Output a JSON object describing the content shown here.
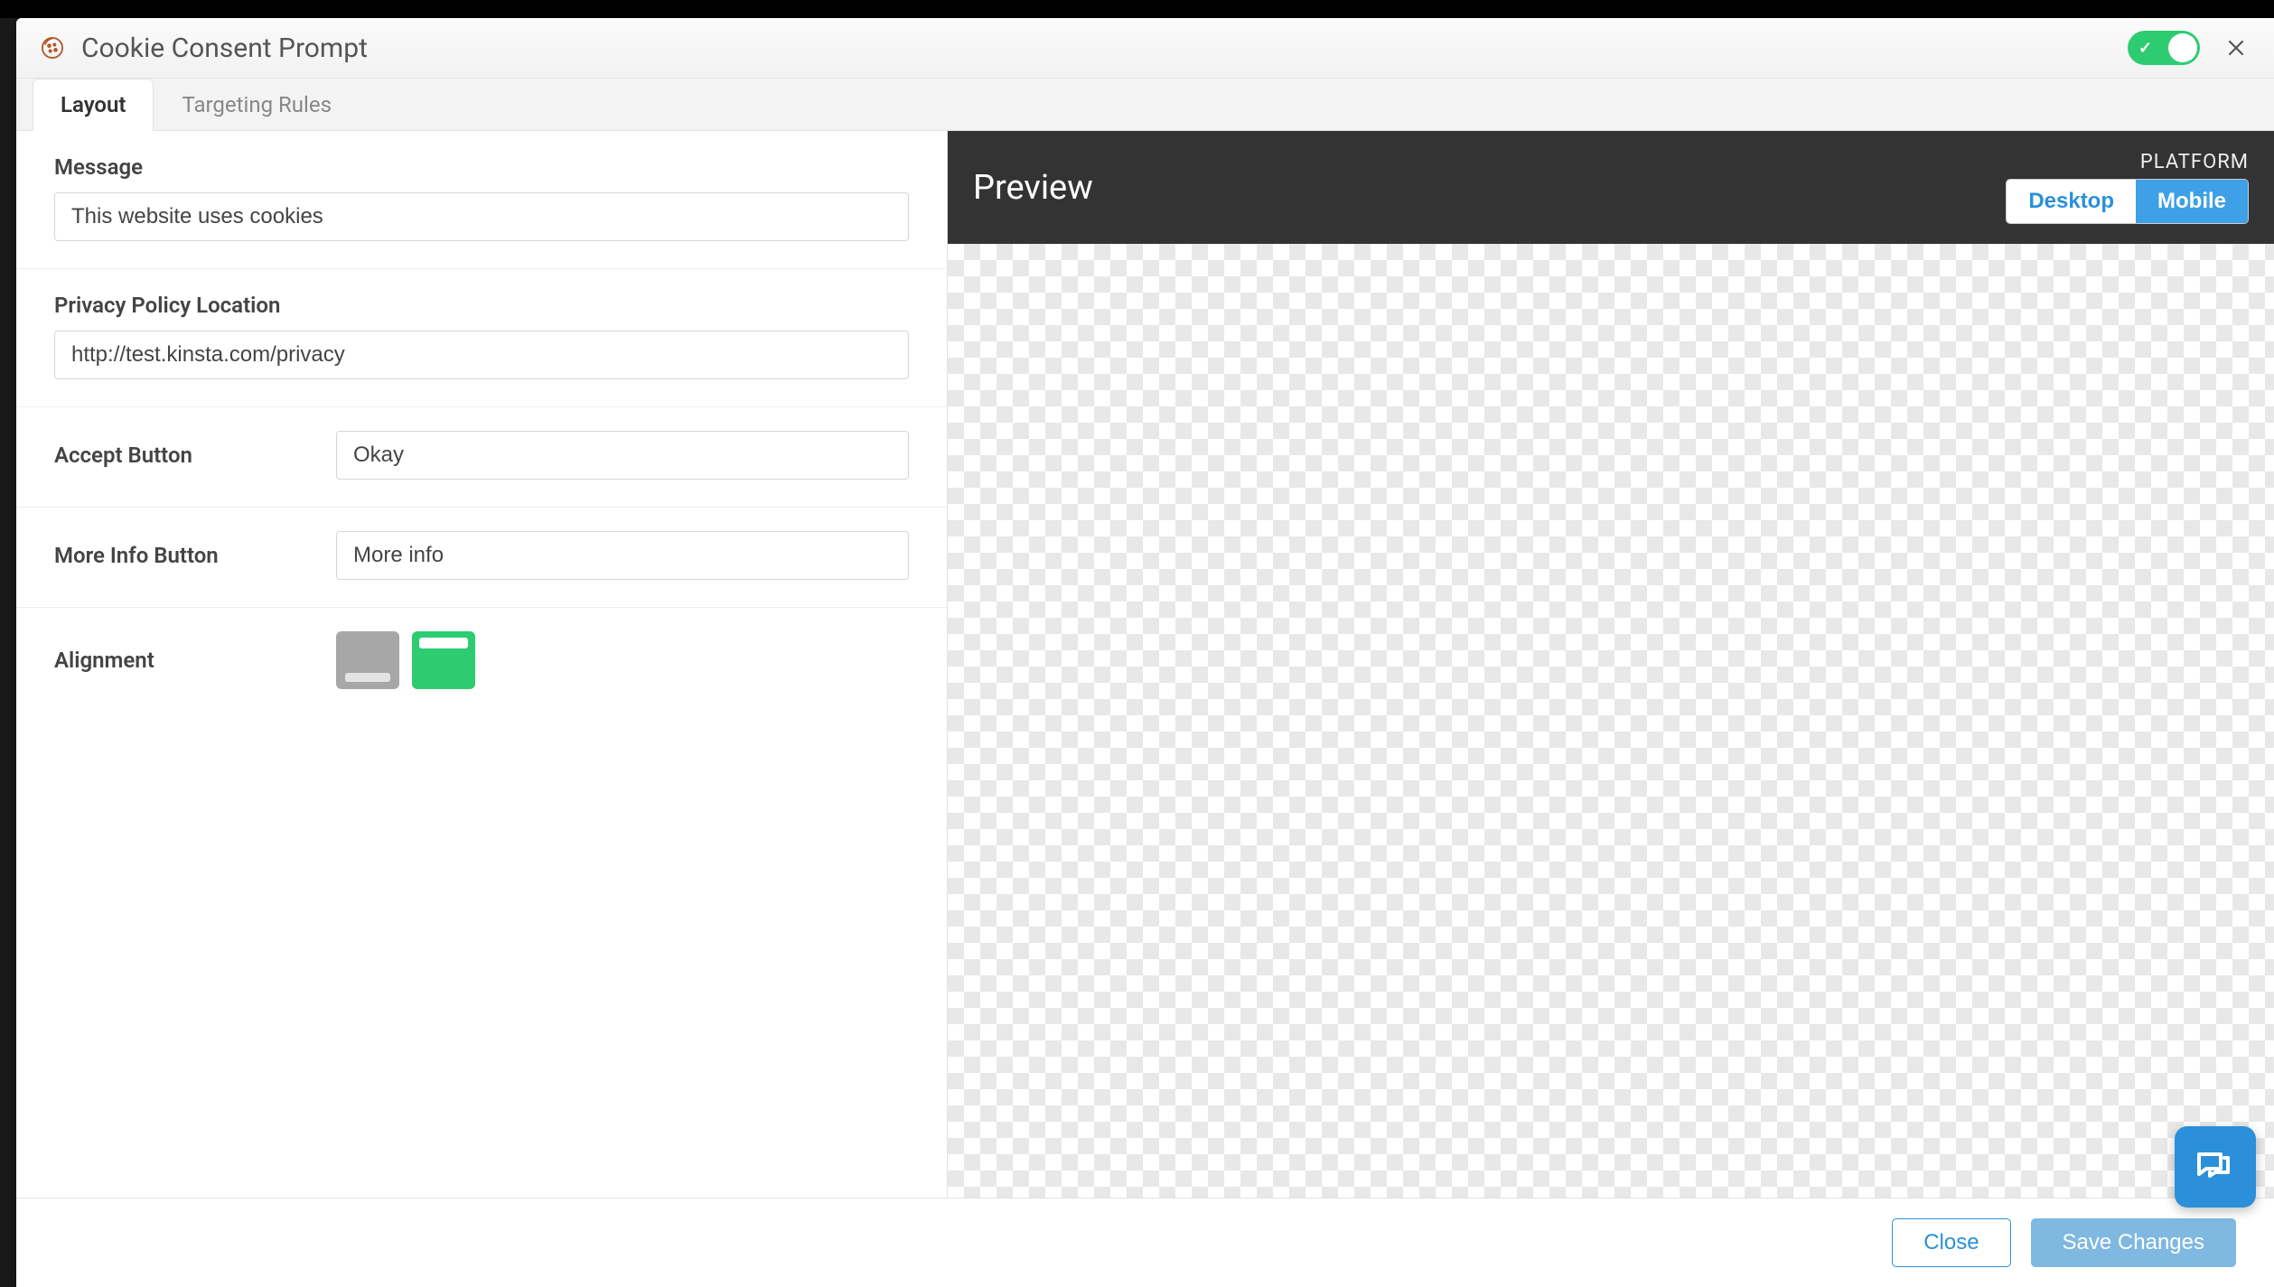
{
  "header": {
    "title": "Cookie Consent Prompt",
    "toggle_on": true
  },
  "tabs": [
    {
      "label": "Layout",
      "active": true
    },
    {
      "label": "Targeting Rules",
      "active": false
    }
  ],
  "form": {
    "message_label": "Message",
    "message_value": "This website uses cookies",
    "privacy_label": "Privacy Policy Location",
    "privacy_value": "http://test.kinsta.com/privacy",
    "accept_label": "Accept Button",
    "accept_value": "Okay",
    "moreinfo_label": "More Info Button",
    "moreinfo_value": "More info",
    "alignment_label": "Alignment"
  },
  "preview": {
    "title": "Preview",
    "platform_label": "PLATFORM",
    "desktop": "Desktop",
    "mobile": "Mobile",
    "active_platform": "Mobile"
  },
  "footer": {
    "close": "Close",
    "save": "Save Changes"
  }
}
